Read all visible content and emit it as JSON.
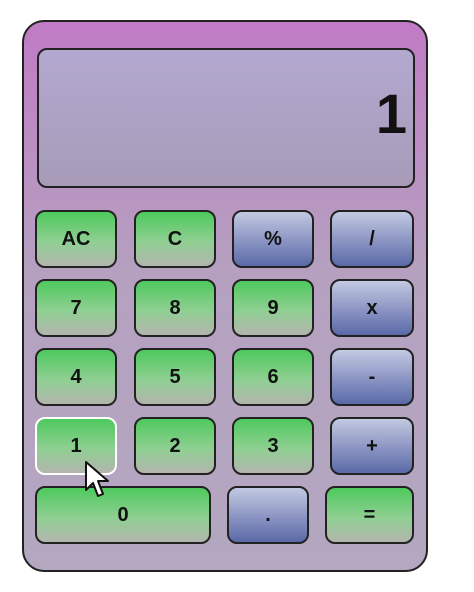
{
  "display": {
    "value": "1"
  },
  "keys": {
    "ac": "AC",
    "c": "C",
    "percent": "%",
    "divide": "/",
    "seven": "7",
    "eight": "8",
    "nine": "9",
    "multiply": "x",
    "four": "4",
    "five": "5",
    "six": "6",
    "minus": "-",
    "one": "1",
    "two": "2",
    "three": "3",
    "plus": "+",
    "zero": "0",
    "decimal": ".",
    "equals": "="
  },
  "colors": {
    "number_key": "#4ec95d",
    "operator_key": "#5a6aa8",
    "body": "#c07bc4",
    "screen": "#b3a8d0"
  },
  "icons": {
    "pointer": "mouse-pointer-icon"
  }
}
